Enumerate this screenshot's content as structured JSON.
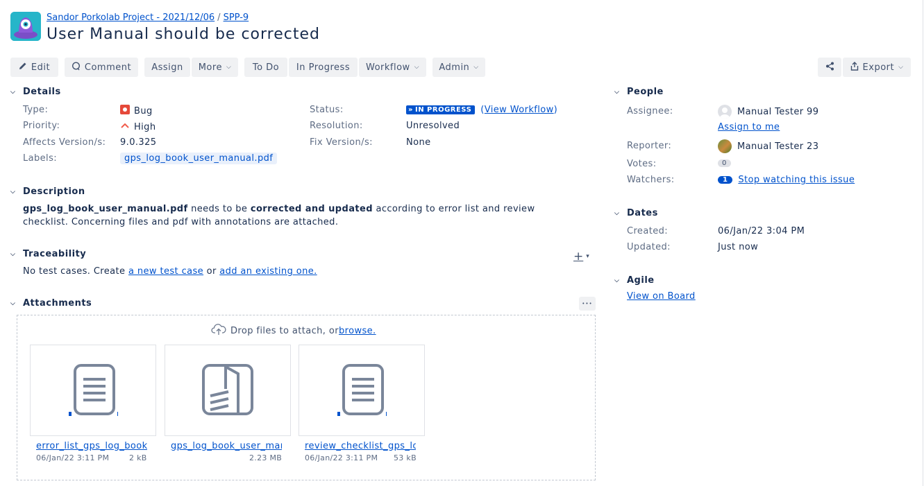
{
  "header": {
    "project_link": "Sandor Porkolab Project - 2021/12/06",
    "separator": "/",
    "issue_key": "SPP-9",
    "title": "User Manual should be corrected"
  },
  "toolbar": {
    "edit": "Edit",
    "comment": "Comment",
    "assign": "Assign",
    "more": "More",
    "todo": "To Do",
    "in_progress": "In Progress",
    "workflow": "Workflow",
    "admin": "Admin",
    "export": "Export"
  },
  "details": {
    "heading": "Details",
    "type_label": "Type:",
    "type_value": "Bug",
    "priority_label": "Priority:",
    "priority_value": "High",
    "affects_label": "Affects Version/s:",
    "affects_value": "9.0.325",
    "labels_label": "Labels:",
    "labels_value": "gps_log_book_user_manual.pdf",
    "status_label": "Status:",
    "status_value": "IN PROGRESS",
    "view_workflow_open": "(",
    "view_workflow": "View Workflow",
    "view_workflow_close": ")",
    "resolution_label": "Resolution:",
    "resolution_value": "Unresolved",
    "fix_label": "Fix Version/s:",
    "fix_value": "None"
  },
  "description": {
    "heading": "Description",
    "part1_bold": "gps_log_book_user_manual.pdf",
    "part2": " needs to be ",
    "part3_bold": "corrected and updated",
    "part4": " according to error list and review checklist. Concerning files and pdf with annotations are attached."
  },
  "traceability": {
    "heading": "Traceability",
    "text1": "No test cases. Create ",
    "link1": "a new test case",
    "text2": " or ",
    "link2": "add an existing one."
  },
  "attachments": {
    "heading": "Attachments",
    "more": "•••",
    "drop_text": "Drop files to attach, or ",
    "browse": "browse.",
    "files": [
      {
        "name": "error_list_gps_log_book",
        "date": "06/Jan/22 3:11 PM",
        "size": "2 kB"
      },
      {
        "name": "gps_log_book_user_manual",
        "date": "",
        "size": "2.23 MB"
      },
      {
        "name": "review_checklist_gps_log",
        "date": "06/Jan/22 3:11 PM",
        "size": "53 kB"
      }
    ]
  },
  "people": {
    "heading": "People",
    "assignee_label": "Assignee:",
    "assignee_value": "Manual Tester 99",
    "assign_to_me": "Assign to me",
    "reporter_label": "Reporter:",
    "reporter_value": "Manual Tester 23",
    "votes_label": "Votes:",
    "votes_value": "0",
    "watchers_label": "Watchers:",
    "watchers_count": "1",
    "watchers_link": "Stop watching this issue"
  },
  "dates": {
    "heading": "Dates",
    "created_label": "Created:",
    "created_value": "06/Jan/22 3:04 PM",
    "updated_label": "Updated:",
    "updated_value": "Just now"
  },
  "agile": {
    "heading": "Agile",
    "view_on_board": "View on Board"
  },
  "colors": {
    "link": "#0052cc",
    "button_bg": "#f0f1f3",
    "bug": "#e5493a",
    "priority_high": "#f15c4c",
    "status_in_progress": "#0052cc"
  }
}
